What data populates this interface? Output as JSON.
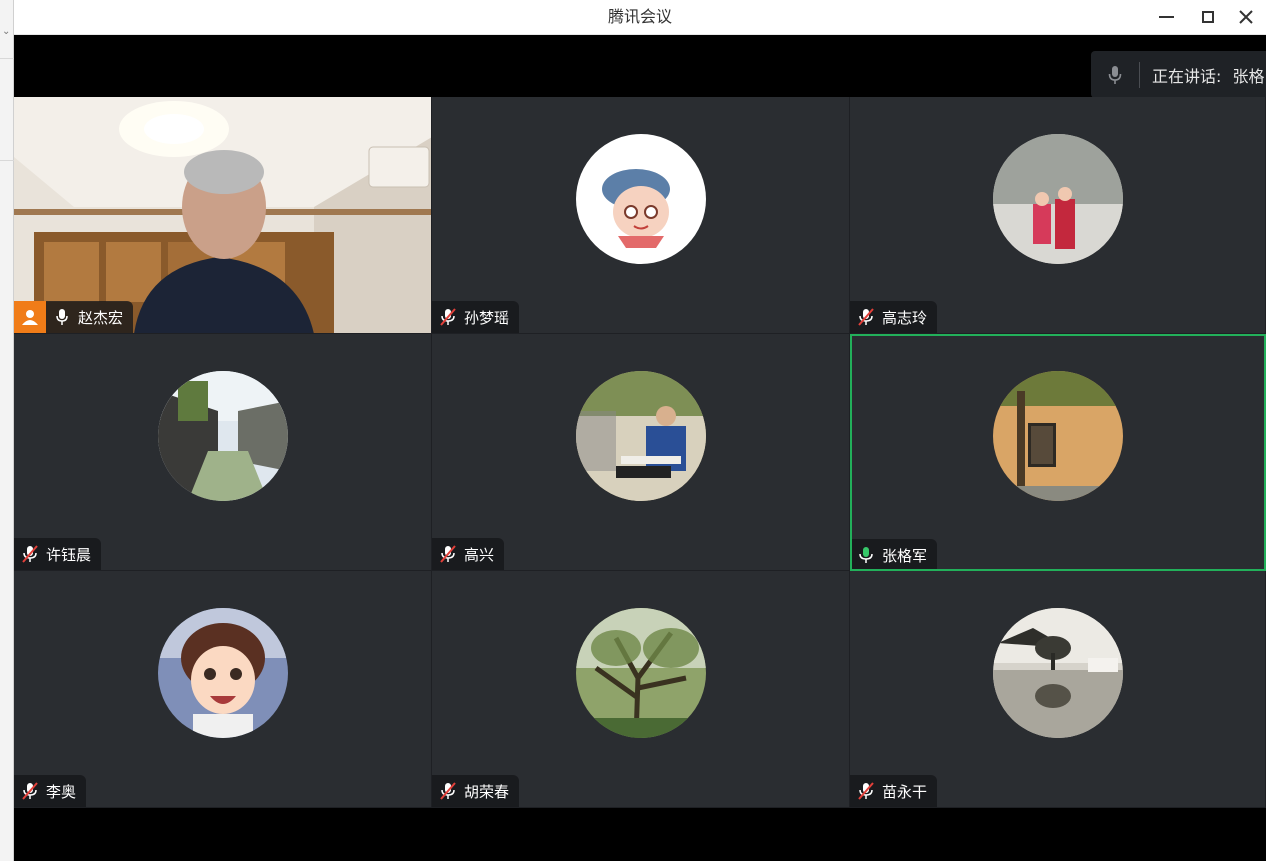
{
  "window": {
    "title": "腾讯会议"
  },
  "speaking": {
    "label": "正在讲话:",
    "name": "张格"
  },
  "participants": [
    {
      "name": "赵杰宏",
      "mic": "on",
      "host": true,
      "video": true
    },
    {
      "name": "孙梦瑶",
      "mic": "muted"
    },
    {
      "name": "高志玲",
      "mic": "muted"
    },
    {
      "name": "许钰晨",
      "mic": "muted"
    },
    {
      "name": "高兴",
      "mic": "muted"
    },
    {
      "name": "张格军",
      "mic": "speaking",
      "active": true
    },
    {
      "name": "李奥",
      "mic": "muted"
    },
    {
      "name": "胡荣春",
      "mic": "muted"
    },
    {
      "name": "苗永干",
      "mic": "muted"
    }
  ],
  "colors": {
    "active_border": "#22b05a",
    "host_badge": "#f07c18",
    "tile_bg": "#2a2d31"
  },
  "icons": {
    "mic": "mic-icon",
    "muted": "mic-muted-icon",
    "host": "host-icon"
  }
}
